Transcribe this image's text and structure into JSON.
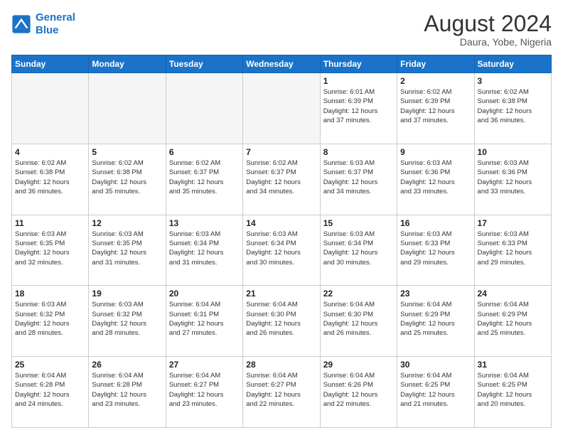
{
  "header": {
    "logo_line1": "General",
    "logo_line2": "Blue",
    "month_year": "August 2024",
    "location": "Daura, Yobe, Nigeria"
  },
  "days_of_week": [
    "Sunday",
    "Monday",
    "Tuesday",
    "Wednesday",
    "Thursday",
    "Friday",
    "Saturday"
  ],
  "weeks": [
    [
      {
        "day": "",
        "info": ""
      },
      {
        "day": "",
        "info": ""
      },
      {
        "day": "",
        "info": ""
      },
      {
        "day": "",
        "info": ""
      },
      {
        "day": "1",
        "info": "Sunrise: 6:01 AM\nSunset: 6:39 PM\nDaylight: 12 hours\nand 37 minutes."
      },
      {
        "day": "2",
        "info": "Sunrise: 6:02 AM\nSunset: 6:39 PM\nDaylight: 12 hours\nand 37 minutes."
      },
      {
        "day": "3",
        "info": "Sunrise: 6:02 AM\nSunset: 6:38 PM\nDaylight: 12 hours\nand 36 minutes."
      }
    ],
    [
      {
        "day": "4",
        "info": "Sunrise: 6:02 AM\nSunset: 6:38 PM\nDaylight: 12 hours\nand 36 minutes."
      },
      {
        "day": "5",
        "info": "Sunrise: 6:02 AM\nSunset: 6:38 PM\nDaylight: 12 hours\nand 35 minutes."
      },
      {
        "day": "6",
        "info": "Sunrise: 6:02 AM\nSunset: 6:37 PM\nDaylight: 12 hours\nand 35 minutes."
      },
      {
        "day": "7",
        "info": "Sunrise: 6:02 AM\nSunset: 6:37 PM\nDaylight: 12 hours\nand 34 minutes."
      },
      {
        "day": "8",
        "info": "Sunrise: 6:03 AM\nSunset: 6:37 PM\nDaylight: 12 hours\nand 34 minutes."
      },
      {
        "day": "9",
        "info": "Sunrise: 6:03 AM\nSunset: 6:36 PM\nDaylight: 12 hours\nand 33 minutes."
      },
      {
        "day": "10",
        "info": "Sunrise: 6:03 AM\nSunset: 6:36 PM\nDaylight: 12 hours\nand 33 minutes."
      }
    ],
    [
      {
        "day": "11",
        "info": "Sunrise: 6:03 AM\nSunset: 6:35 PM\nDaylight: 12 hours\nand 32 minutes."
      },
      {
        "day": "12",
        "info": "Sunrise: 6:03 AM\nSunset: 6:35 PM\nDaylight: 12 hours\nand 31 minutes."
      },
      {
        "day": "13",
        "info": "Sunrise: 6:03 AM\nSunset: 6:34 PM\nDaylight: 12 hours\nand 31 minutes."
      },
      {
        "day": "14",
        "info": "Sunrise: 6:03 AM\nSunset: 6:34 PM\nDaylight: 12 hours\nand 30 minutes."
      },
      {
        "day": "15",
        "info": "Sunrise: 6:03 AM\nSunset: 6:34 PM\nDaylight: 12 hours\nand 30 minutes."
      },
      {
        "day": "16",
        "info": "Sunrise: 6:03 AM\nSunset: 6:33 PM\nDaylight: 12 hours\nand 29 minutes."
      },
      {
        "day": "17",
        "info": "Sunrise: 6:03 AM\nSunset: 6:33 PM\nDaylight: 12 hours\nand 29 minutes."
      }
    ],
    [
      {
        "day": "18",
        "info": "Sunrise: 6:03 AM\nSunset: 6:32 PM\nDaylight: 12 hours\nand 28 minutes."
      },
      {
        "day": "19",
        "info": "Sunrise: 6:03 AM\nSunset: 6:32 PM\nDaylight: 12 hours\nand 28 minutes."
      },
      {
        "day": "20",
        "info": "Sunrise: 6:04 AM\nSunset: 6:31 PM\nDaylight: 12 hours\nand 27 minutes."
      },
      {
        "day": "21",
        "info": "Sunrise: 6:04 AM\nSunset: 6:30 PM\nDaylight: 12 hours\nand 26 minutes."
      },
      {
        "day": "22",
        "info": "Sunrise: 6:04 AM\nSunset: 6:30 PM\nDaylight: 12 hours\nand 26 minutes."
      },
      {
        "day": "23",
        "info": "Sunrise: 6:04 AM\nSunset: 6:29 PM\nDaylight: 12 hours\nand 25 minutes."
      },
      {
        "day": "24",
        "info": "Sunrise: 6:04 AM\nSunset: 6:29 PM\nDaylight: 12 hours\nand 25 minutes."
      }
    ],
    [
      {
        "day": "25",
        "info": "Sunrise: 6:04 AM\nSunset: 6:28 PM\nDaylight: 12 hours\nand 24 minutes."
      },
      {
        "day": "26",
        "info": "Sunrise: 6:04 AM\nSunset: 6:28 PM\nDaylight: 12 hours\nand 23 minutes."
      },
      {
        "day": "27",
        "info": "Sunrise: 6:04 AM\nSunset: 6:27 PM\nDaylight: 12 hours\nand 23 minutes."
      },
      {
        "day": "28",
        "info": "Sunrise: 6:04 AM\nSunset: 6:27 PM\nDaylight: 12 hours\nand 22 minutes."
      },
      {
        "day": "29",
        "info": "Sunrise: 6:04 AM\nSunset: 6:26 PM\nDaylight: 12 hours\nand 22 minutes."
      },
      {
        "day": "30",
        "info": "Sunrise: 6:04 AM\nSunset: 6:25 PM\nDaylight: 12 hours\nand 21 minutes."
      },
      {
        "day": "31",
        "info": "Sunrise: 6:04 AM\nSunset: 6:25 PM\nDaylight: 12 hours\nand 20 minutes."
      }
    ]
  ]
}
